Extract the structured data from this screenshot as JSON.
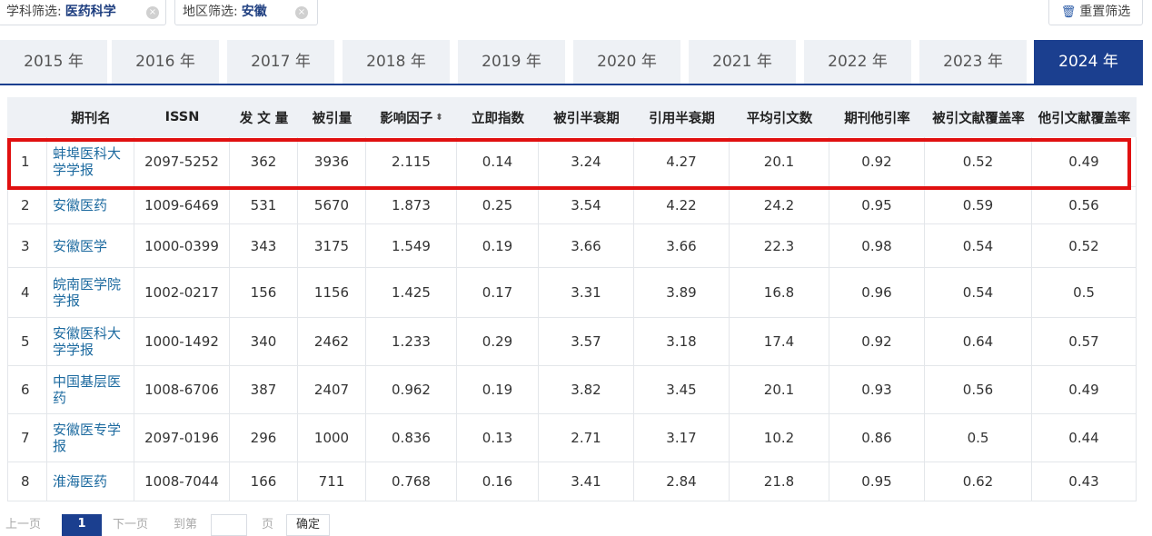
{
  "filters": {
    "subject_label": "学科筛选:",
    "subject_value": "医药科学",
    "region_label": "地区筛选:",
    "region_value": "安徽",
    "reset_label": "重置筛选",
    "clear_glyph": "×",
    "reset_icon": "trash-icon"
  },
  "years": [
    "2015 年",
    "2016 年",
    "2017 年",
    "2018 年",
    "2019 年",
    "2020 年",
    "2021 年",
    "2022 年",
    "2023 年",
    "2024 年"
  ],
  "active_year": "2024 年",
  "table": {
    "headers": [
      "",
      "期刊名",
      "ISSN",
      "发 文 量",
      "被引量",
      "影响因子",
      "立即指数",
      "被引半衰期",
      "引用半衰期",
      "平均引文数",
      "期刊他引率",
      "被引文献覆盖率",
      "他引文献覆盖率"
    ],
    "sort_glyph": "⬍",
    "rows": [
      {
        "rank": "1",
        "name": "蚌埠医科大学学报",
        "issn": "2097-5252",
        "articles": "362",
        "citations": "3936",
        "impact": "2.115",
        "immediacy": "0.14",
        "cited_half_life": "3.24",
        "citing_half_life": "4.27",
        "avg_refs": "20.1",
        "self_cite_rate": "0.92",
        "cited_coverage": "0.52",
        "other_coverage": "0.49"
      },
      {
        "rank": "2",
        "name": "安徽医药",
        "issn": "1009-6469",
        "articles": "531",
        "citations": "5670",
        "impact": "1.873",
        "immediacy": "0.25",
        "cited_half_life": "3.54",
        "citing_half_life": "4.22",
        "avg_refs": "24.2",
        "self_cite_rate": "0.95",
        "cited_coverage": "0.59",
        "other_coverage": "0.56"
      },
      {
        "rank": "3",
        "name": "安徽医学",
        "issn": "1000-0399",
        "articles": "343",
        "citations": "3175",
        "impact": "1.549",
        "immediacy": "0.19",
        "cited_half_life": "3.66",
        "citing_half_life": "3.66",
        "avg_refs": "22.3",
        "self_cite_rate": "0.98",
        "cited_coverage": "0.54",
        "other_coverage": "0.52"
      },
      {
        "rank": "4",
        "name": "皖南医学院学报",
        "issn": "1002-0217",
        "articles": "156",
        "citations": "1156",
        "impact": "1.425",
        "immediacy": "0.17",
        "cited_half_life": "3.31",
        "citing_half_life": "3.89",
        "avg_refs": "16.8",
        "self_cite_rate": "0.96",
        "cited_coverage": "0.54",
        "other_coverage": "0.5"
      },
      {
        "rank": "5",
        "name": "安徽医科大学学报",
        "issn": "1000-1492",
        "articles": "340",
        "citations": "2462",
        "impact": "1.233",
        "immediacy": "0.29",
        "cited_half_life": "3.57",
        "citing_half_life": "3.18",
        "avg_refs": "17.4",
        "self_cite_rate": "0.92",
        "cited_coverage": "0.64",
        "other_coverage": "0.57"
      },
      {
        "rank": "6",
        "name": "中国基层医药",
        "issn": "1008-6706",
        "articles": "387",
        "citations": "2407",
        "impact": "0.962",
        "immediacy": "0.19",
        "cited_half_life": "3.82",
        "citing_half_life": "3.45",
        "avg_refs": "20.1",
        "self_cite_rate": "0.93",
        "cited_coverage": "0.56",
        "other_coverage": "0.49"
      },
      {
        "rank": "7",
        "name": "安徽医专学报",
        "issn": "2097-0196",
        "articles": "296",
        "citations": "1000",
        "impact": "0.836",
        "immediacy": "0.13",
        "cited_half_life": "2.71",
        "citing_half_life": "3.17",
        "avg_refs": "10.2",
        "self_cite_rate": "0.86",
        "cited_coverage": "0.5",
        "other_coverage": "0.44"
      },
      {
        "rank": "8",
        "name": "淮海医药",
        "issn": "1008-7044",
        "articles": "166",
        "citations": "711",
        "impact": "0.768",
        "immediacy": "0.16",
        "cited_half_life": "3.41",
        "citing_half_life": "2.84",
        "avg_refs": "21.8",
        "self_cite_rate": "0.95",
        "cited_coverage": "0.62",
        "other_coverage": "0.43"
      }
    ]
  },
  "pagination": {
    "prev": "上一页",
    "current": "1",
    "next": "下一页",
    "goto_label": "到第",
    "page_unit": "页",
    "confirm": "确定"
  },
  "colors": {
    "accent": "#1b3f8f",
    "link": "#1e6ba0",
    "highlight_border": "#e01010"
  }
}
